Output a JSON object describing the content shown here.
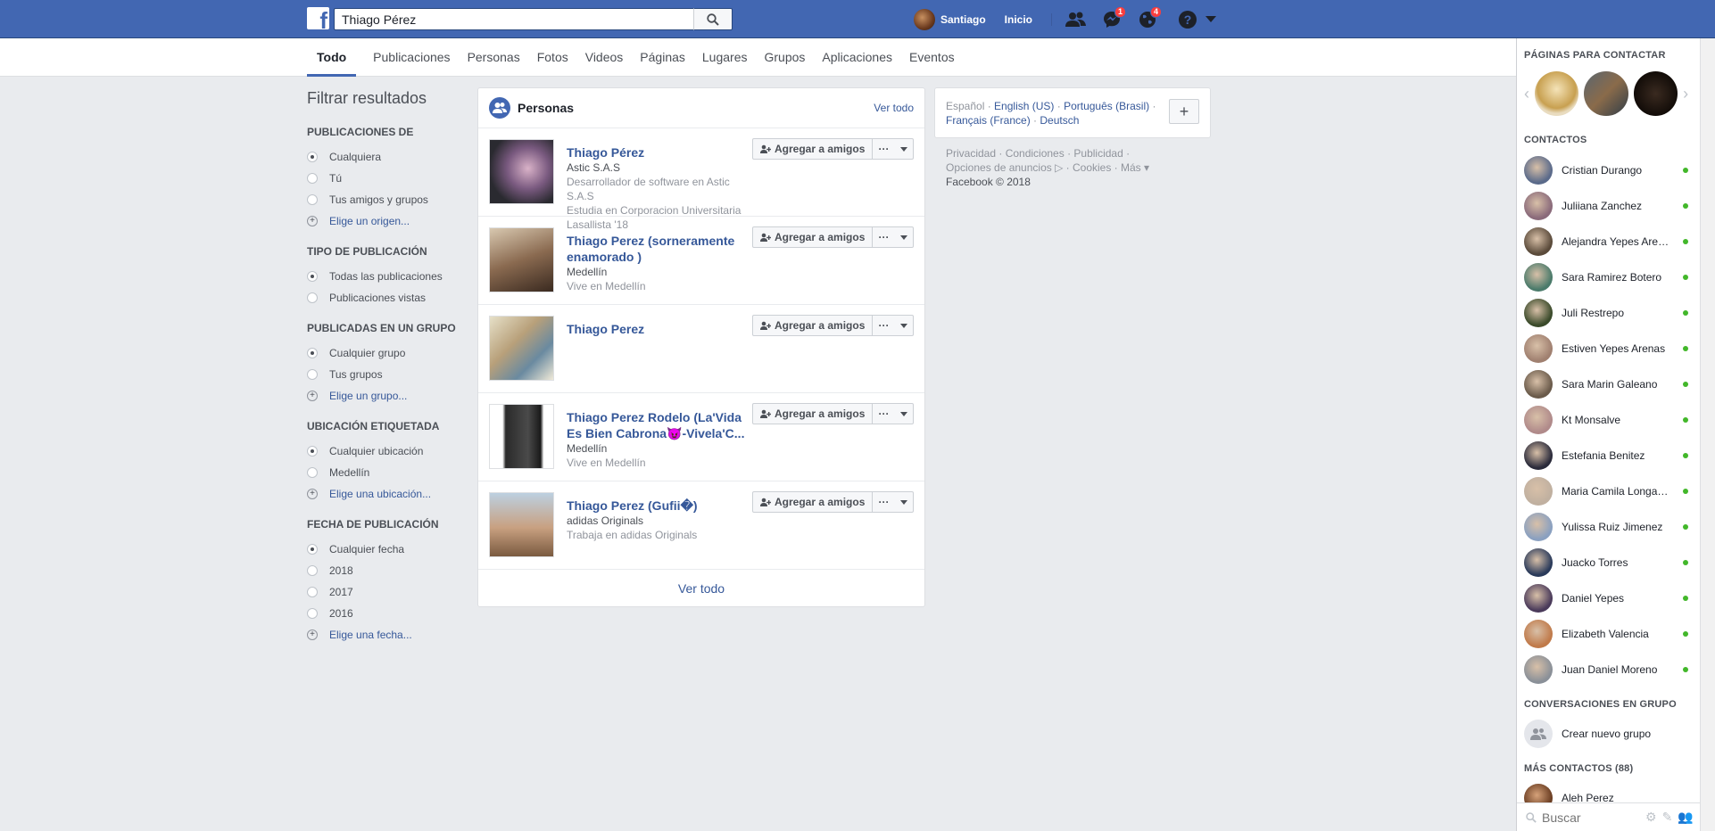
{
  "topbar": {
    "logo": "f",
    "search_value": "Thiago Pérez",
    "user_name": "Santiago",
    "home_label": "Inicio",
    "messages_badge": "1",
    "notifications_badge": "4",
    "help_label": "?"
  },
  "tabs": [
    "Todo",
    "Publicaciones",
    "Personas",
    "Fotos",
    "Videos",
    "Páginas",
    "Lugares",
    "Grupos",
    "Aplicaciones",
    "Eventos"
  ],
  "filters": {
    "title": "Filtrar resultados",
    "groups": [
      {
        "heading": "PUBLICACIONES DE",
        "options": [
          "Cualquiera",
          "Tú",
          "Tus amigos y grupos"
        ],
        "add": "Elige un origen..."
      },
      {
        "heading": "TIPO DE PUBLICACIÓN",
        "options": [
          "Todas las publicaciones",
          "Publicaciones vistas"
        ]
      },
      {
        "heading": "PUBLICADAS EN UN GRUPO",
        "options": [
          "Cualquier grupo",
          "Tus grupos"
        ],
        "add": "Elige un grupo..."
      },
      {
        "heading": "UBICACIÓN ETIQUETADA",
        "options": [
          "Cualquier ubicación",
          "Medellín"
        ],
        "add": "Elige una ubicación..."
      },
      {
        "heading": "FECHA DE PUBLICACIÓN",
        "options": [
          "Cualquier fecha",
          "2018",
          "2017",
          "2016"
        ],
        "add": "Elige una fecha..."
      }
    ]
  },
  "people": {
    "title": "Personas",
    "see_all": "Ver todo",
    "footer": "Ver todo",
    "add_label": "Agregar a amigos",
    "more_label": "···",
    "results": [
      {
        "name": "Thiago Pérez",
        "line1": "Astic S.A.S",
        "line2": "Desarrollador de software en Astic S.A.S",
        "line3": "Estudia en Corporacion Universitaria Lasallista '18"
      },
      {
        "name": "Thiago Perez (sorneramente enamorado )",
        "line1": "Medellín",
        "line2": "Vive en Medellín",
        "line3": ""
      },
      {
        "name": "Thiago Perez",
        "line1": "",
        "line2": "",
        "line3": ""
      },
      {
        "name": "Thiago Perez Rodelo (La'Vida Es Bien Cabrona😈-Vivela'C...",
        "line1": "Medellín",
        "line2": "Vive en Medellín",
        "line3": ""
      },
      {
        "name": "Thiago Perez (Gufii�)",
        "line1": "adidas Originals",
        "line2": "Trabaja en adidas Originals",
        "line3": ""
      }
    ]
  },
  "languages": {
    "current": "Español",
    "others": [
      "English (US)",
      "Português (Brasil)",
      "Français (France)",
      "Deutsch"
    ],
    "add": "+"
  },
  "footer": {
    "links1": "Privacidad · Condiciones · Publicidad ·",
    "links2": "Opciones de anuncios ▷ · Cookies · Más ▾",
    "copyright": "Facebook © 2018"
  },
  "sidebar": {
    "pages_heading": "PÁGINAS PARA CONTACTAR",
    "contacts_heading": "CONTACTOS",
    "contacts": [
      "Cristian Durango",
      "Juliiana Zanchez",
      "Alejandra Yepes Arenas",
      "Sara Ramirez Botero",
      "Juli Restrepo",
      "Estiven Yepes Arenas",
      "Sara Marin Galeano",
      "Kt Monsalve",
      "Estefania Benitez",
      "Maria Camila Longas Velez",
      "Yulissa Ruiz Jimenez",
      "Juacko Torres",
      "Daniel Yepes",
      "Elizabeth Valencia",
      "Juan Daniel Moreno"
    ],
    "group_heading": "CONVERSACIONES EN GRUPO",
    "new_group": "Crear nuevo grupo",
    "more_heading": "MÁS CONTACTOS (88)",
    "more_contacts": [
      "Aleh Perez"
    ],
    "search_placeholder": "Buscar"
  },
  "colors": {
    "brand": "#4267b2",
    "link": "#365899",
    "online": "#42b72a",
    "badge": "#fa3e3e"
  }
}
